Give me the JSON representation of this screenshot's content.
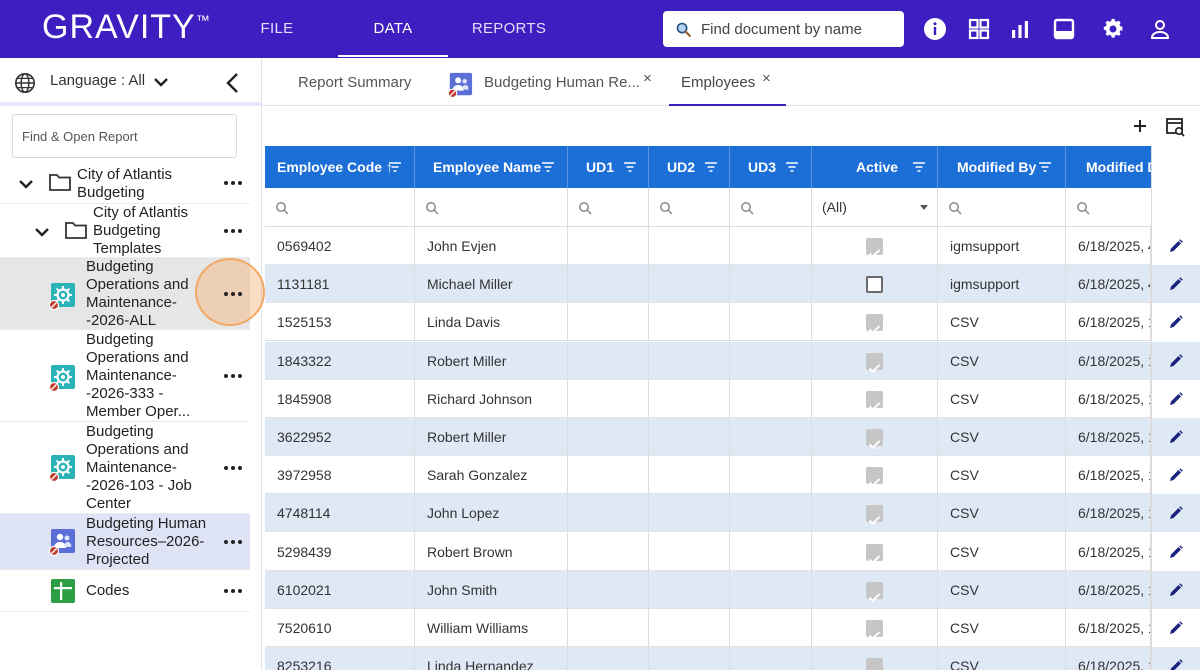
{
  "app": {
    "logo_text": "GRAVITY",
    "logo_tm": "™",
    "nav": [
      "FILE",
      "DATA",
      "REPORTS"
    ],
    "active_nav": "DATA",
    "search_placeholder": "Find document by name",
    "brand_color": "#3d1fc1",
    "icons": [
      "info-icon",
      "dashboard-grid-icon",
      "bar-chart-icon",
      "book-icon",
      "gear-icon",
      "user-icon"
    ]
  },
  "sidebar": {
    "language_label": "Language : All",
    "find_placeholder": "Find & Open Report",
    "tree": [
      {
        "label": "City of Atlantis Budgeting",
        "kind": "folder",
        "expanded": true
      },
      {
        "label": "City of Atlantis Budgeting Templates",
        "kind": "folder",
        "expanded": true
      },
      {
        "label": "Budgeting Operations and Maintenance--2026-ALL",
        "kind": "gear-report",
        "selected": true
      },
      {
        "label": "Budgeting Operations and Maintenance--2026-333 - Member Oper...",
        "kind": "gear-report"
      },
      {
        "label": "Budgeting Operations and Maintenance--2026-103 - Job Center",
        "kind": "gear-report"
      },
      {
        "label": "Budgeting Human Resources–2026-Projected",
        "kind": "people-report",
        "highlighted": true
      },
      {
        "label": "Codes",
        "kind": "codes"
      }
    ]
  },
  "tabs": [
    {
      "label": "Report Summary",
      "closable": false
    },
    {
      "label": "Budgeting Human Re...",
      "closable": true,
      "close": "×"
    },
    {
      "label": "Employees",
      "closable": true,
      "close": "×",
      "active": true
    }
  ],
  "grid": {
    "header_color": "#1d6fd8",
    "columns": [
      "Employee Code",
      "Employee Name",
      "UD1",
      "UD2",
      "UD3",
      "Active",
      "Modified By",
      "Modified D"
    ],
    "sort_indicator": "↑",
    "active_filter": "(All)",
    "rows": [
      {
        "code": "0569402",
        "name": "John Evjen",
        "active": true,
        "modified_by": "igmsupport",
        "modified_date": "6/18/2025, 4"
      },
      {
        "code": "1131181",
        "name": "Michael Miller",
        "active": false,
        "modified_by": "igmsupport",
        "modified_date": "6/18/2025, 4"
      },
      {
        "code": "1525153",
        "name": "Linda Davis",
        "active": true,
        "modified_by": "CSV",
        "modified_date": "6/18/2025, 1"
      },
      {
        "code": "1843322",
        "name": "Robert Miller",
        "active": true,
        "modified_by": "CSV",
        "modified_date": "6/18/2025, 1"
      },
      {
        "code": "1845908",
        "name": "Richard Johnson",
        "active": true,
        "modified_by": "CSV",
        "modified_date": "6/18/2025, 1"
      },
      {
        "code": "3622952",
        "name": "Robert Miller",
        "active": true,
        "modified_by": "CSV",
        "modified_date": "6/18/2025, 1"
      },
      {
        "code": "3972958",
        "name": "Sarah Gonzalez",
        "active": true,
        "modified_by": "CSV",
        "modified_date": "6/18/2025, 1"
      },
      {
        "code": "4748114",
        "name": "John Lopez",
        "active": true,
        "modified_by": "CSV",
        "modified_date": "6/18/2025, 1"
      },
      {
        "code": "5298439",
        "name": "Robert Brown",
        "active": true,
        "modified_by": "CSV",
        "modified_date": "6/18/2025, 1"
      },
      {
        "code": "6102021",
        "name": "John Smith",
        "active": true,
        "modified_by": "CSV",
        "modified_date": "6/18/2025, 1"
      },
      {
        "code": "7520610",
        "name": "William Williams",
        "active": true,
        "modified_by": "CSV",
        "modified_date": "6/18/2025, 1"
      },
      {
        "code": "8253216",
        "name": "Linda Hernandez",
        "active": true,
        "modified_by": "CSV",
        "modified_date": "6/18/2025, 1"
      }
    ]
  }
}
